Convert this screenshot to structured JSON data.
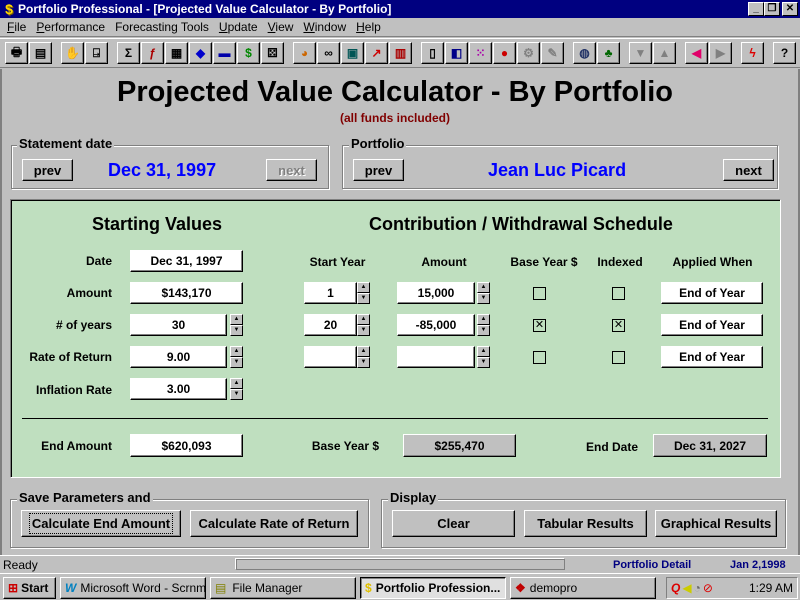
{
  "window": {
    "title": "Portfolio Professional - [Projected Value Calculator - By Portfolio]",
    "app_icon": "$"
  },
  "menu": [
    {
      "label": "File",
      "key": "F",
      "rest": "ile"
    },
    {
      "label": "Performance",
      "key": "P",
      "rest": "erformance"
    },
    {
      "label": "Forecasting Tools",
      "key": "",
      "rest": "Forecasting Tools"
    },
    {
      "label": "Update",
      "key": "U",
      "rest": "pdate"
    },
    {
      "label": "View",
      "key": "V",
      "rest": "iew"
    },
    {
      "label": "Window",
      "key": "W",
      "rest": "indow"
    },
    {
      "label": "Help",
      "key": "H",
      "rest": "elp"
    }
  ],
  "toolbar_icons": [
    {
      "name": "print-icon",
      "glyph": "🖶"
    },
    {
      "name": "preview-icon",
      "glyph": "▤"
    },
    {
      "name": "stop-hand-icon",
      "glyph": "✋"
    },
    {
      "name": "exit-door-icon",
      "glyph": "⍈"
    },
    {
      "name": "sum-icon",
      "glyph": "Σ"
    },
    {
      "name": "function-icon",
      "glyph": "ƒ"
    },
    {
      "name": "table-icon",
      "glyph": "▦"
    },
    {
      "name": "shapes-icon",
      "glyph": "◆"
    },
    {
      "name": "stacked-bars-icon",
      "glyph": "▬"
    },
    {
      "name": "money-bag-icon",
      "glyph": "$"
    },
    {
      "name": "dice-icon",
      "glyph": "⚄"
    },
    {
      "name": "pie-chart-icon",
      "glyph": "◕"
    },
    {
      "name": "binoculars-icon",
      "glyph": "∞"
    },
    {
      "name": "calculator-icon",
      "glyph": "▣"
    },
    {
      "name": "line-chart-icon",
      "glyph": "↗"
    },
    {
      "name": "bar-chart-icon",
      "glyph": "▥"
    },
    {
      "name": "columns-icon",
      "glyph": "▯"
    },
    {
      "name": "book-icon",
      "glyph": "◧"
    },
    {
      "name": "grid-dots-icon",
      "glyph": "⁙"
    },
    {
      "name": "color-shapes-icon",
      "glyph": "●"
    },
    {
      "name": "gear-disabled-icon",
      "glyph": "⚙"
    },
    {
      "name": "eraser-disabled-icon",
      "glyph": "✎"
    },
    {
      "name": "globe-icon",
      "glyph": "◍"
    },
    {
      "name": "tree-icon",
      "glyph": "♣"
    },
    {
      "name": "down-arrow-disabled-icon",
      "glyph": "▼"
    },
    {
      "name": "up-arrow-disabled-icon",
      "glyph": "▲"
    },
    {
      "name": "left-arrow-icon",
      "glyph": "◀"
    },
    {
      "name": "right-arrow-disabled-icon",
      "glyph": "▶"
    },
    {
      "name": "lightning-icon",
      "glyph": "ϟ"
    },
    {
      "name": "help-icon",
      "glyph": "?"
    }
  ],
  "page": {
    "title": "Projected Value Calculator - By Portfolio",
    "subtitle": "(all funds included)"
  },
  "statement": {
    "legend": "Statement date",
    "prev": "prev",
    "next": "next",
    "value": "Dec 31, 1997"
  },
  "portfolio": {
    "legend": "Portfolio",
    "prev": "prev",
    "next": "next",
    "value": "Jean Luc Picard"
  },
  "starting": {
    "title": "Starting Values",
    "date_label": "Date",
    "date": "Dec 31, 1997",
    "amount_label": "Amount",
    "amount": "$143,170",
    "years_label": "# of years",
    "years": "30",
    "ror_label": "Rate of Return",
    "ror": "9.00",
    "inflation_label": "Inflation Rate",
    "inflation": "3.00"
  },
  "schedule": {
    "title": "Contribution / Withdrawal Schedule",
    "headers": [
      "Start Year",
      "Amount",
      "Base Year $",
      "Indexed",
      "Applied When"
    ],
    "rows": [
      {
        "start_year": "1",
        "amount": "15,000",
        "base_year": "",
        "indexed": "",
        "applied": "End of Year"
      },
      {
        "start_year": "20",
        "amount": "-85,000",
        "base_year": "☒",
        "indexed": "☒",
        "applied": "End of Year"
      },
      {
        "start_year": "",
        "amount": "",
        "base_year": "",
        "indexed": "",
        "applied": "End of Year"
      }
    ]
  },
  "results": {
    "end_amount_label": "End Amount",
    "end_amount": "$620,093",
    "base_year_label": "Base Year $",
    "base_year": "$255,470",
    "end_date_label": "End Date",
    "end_date": "Dec 31, 2027"
  },
  "save": {
    "legend": "Save Parameters and",
    "calc_end": "Calculate End Amount",
    "calc_ror": "Calculate Rate of Return"
  },
  "display": {
    "legend": "Display",
    "clear": "Clear",
    "tabular": "Tabular Results",
    "graphical": "Graphical Results"
  },
  "status": {
    "text": "Ready",
    "mode": "Portfolio Detail",
    "date": "Jan 2,1998"
  },
  "taskbar": {
    "start": "Start",
    "tasks": [
      "Microsoft Word - Scrnmtrx",
      "File Manager",
      "Portfolio Profession...",
      "demopro"
    ],
    "clock": "1:29 AM"
  }
}
